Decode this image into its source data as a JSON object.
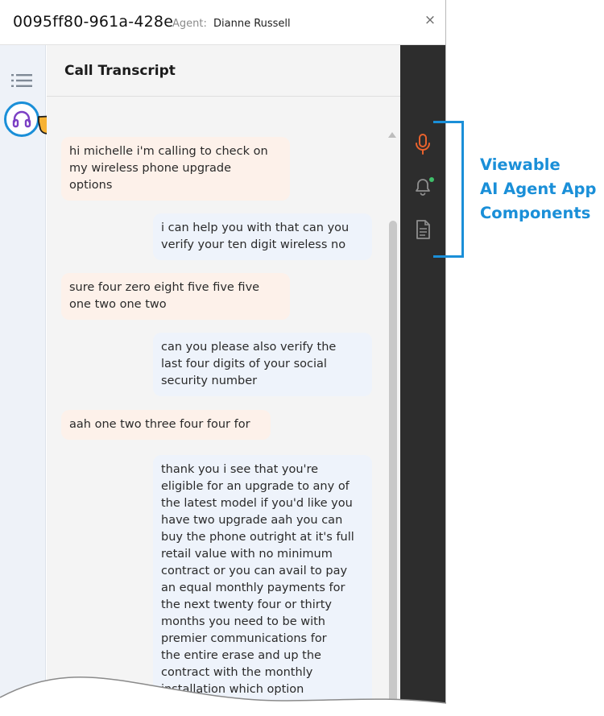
{
  "header": {
    "call_id": "0095ff80-961a-428e",
    "agent_label": "Agent:",
    "agent_name": "Dianne Russell",
    "close_symbol": "×"
  },
  "rail": {
    "list_icon": "list-icon",
    "headset_icon": "headset-icon",
    "pointer_icon": "pointing-hand-icon",
    "headset_color": "#7b3fc4",
    "highlight_color": "#1a8fd8"
  },
  "transcript": {
    "title": "Call Transcript",
    "messages": [
      {
        "speaker": "customer",
        "lines": [
          "hi michelle i'm calling to check on",
          "my wireless phone upgrade",
          "options"
        ]
      },
      {
        "speaker": "agent",
        "lines": [
          "i can help you with that can you",
          "verify your ten digit wireless no"
        ]
      },
      {
        "speaker": "customer",
        "lines": [
          "sure four zero eight five five five",
          "one two one two"
        ]
      },
      {
        "speaker": "agent",
        "lines": [
          "can you please also verify the",
          "last four digits of your social",
          "security number"
        ]
      },
      {
        "speaker": "customer",
        "lines": [
          "aah one two three four four for"
        ]
      },
      {
        "speaker": "agent",
        "lines": [
          "thank you i see that you're",
          "eligible for an upgrade to any of",
          "the latest model if you'd like you",
          "have two upgrade aah you can",
          "buy the phone outright at it's full",
          "retail value with no minimum",
          "contract or you can avail to pay",
          "an equal monthly payments for",
          "the next twenty four or thirty",
          "months you need to be with",
          "premier communications for",
          "the entire erase and up the",
          "contract with the monthly",
          "installation which option"
        ]
      }
    ]
  },
  "apps": {
    "icons": [
      "microphone-icon",
      "bell-icon",
      "document-icon"
    ],
    "mic_color": "#e8622d",
    "muted_color": "#8f8f8f",
    "notification_dot_color": "#3fbf6a"
  },
  "callout": {
    "lines": [
      "Viewable",
      "AI Agent App",
      "Components"
    ],
    "color": "#1a8fd8"
  }
}
